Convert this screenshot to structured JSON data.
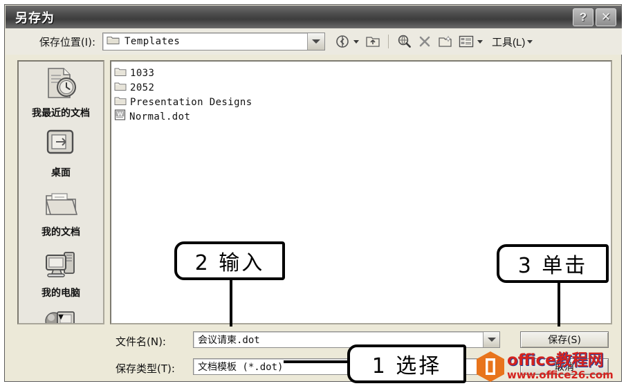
{
  "window": {
    "title": "另存为",
    "help_button": "?",
    "close_button": "✕"
  },
  "toolbar": {
    "save_in_label": "保存位置(I):",
    "location_value": "Templates",
    "location_icon": "folder-icon",
    "buttons": [
      {
        "name": "back-button",
        "icon": "back-arrow-icon",
        "has_dropdown": true
      },
      {
        "name": "up-one-level-button",
        "icon": "up-folder-icon",
        "has_dropdown": false
      },
      {
        "name": "search-web-button",
        "icon": "search-globe-icon",
        "has_dropdown": false
      },
      {
        "name": "delete-button",
        "icon": "delete-x-icon",
        "has_dropdown": false
      },
      {
        "name": "new-folder-button",
        "icon": "new-folder-icon",
        "has_dropdown": false
      },
      {
        "name": "views-button",
        "icon": "views-list-icon",
        "has_dropdown": true
      }
    ],
    "tools_label": "工具(L)"
  },
  "places": [
    {
      "label": "我最近的文档",
      "icon": "recent-documents-icon"
    },
    {
      "label": "桌面",
      "icon": "desktop-icon"
    },
    {
      "label": "我的文档",
      "icon": "my-documents-icon"
    },
    {
      "label": "我的电脑",
      "icon": "my-computer-icon"
    },
    {
      "label": "",
      "icon": "my-network-places-icon"
    }
  ],
  "places_scroll_arrow": "▼",
  "files": [
    {
      "name": "1033",
      "icon": "folder-icon"
    },
    {
      "name": "2052",
      "icon": "folder-icon"
    },
    {
      "name": "Presentation Designs",
      "icon": "folder-icon"
    },
    {
      "name": "Normal.dot",
      "icon": "word-document-icon"
    }
  ],
  "fields": {
    "filename_label": "文件名(N):",
    "filename_value": "会议请柬.dot",
    "filetype_label": "保存类型(T):",
    "filetype_value": "文档模板 (*.dot)"
  },
  "actions": {
    "save_button": "保存(S)",
    "cancel_button": "取消"
  },
  "annotations": [
    {
      "id": "step1",
      "text": "1 选择"
    },
    {
      "id": "step2",
      "text": "2 输入"
    },
    {
      "id": "step3",
      "text": "3 单击"
    }
  ],
  "watermark": {
    "line1": "office教程网",
    "line2": "www.office26.com",
    "logo_color": "#e8741c",
    "text_color": "#d4231f"
  }
}
